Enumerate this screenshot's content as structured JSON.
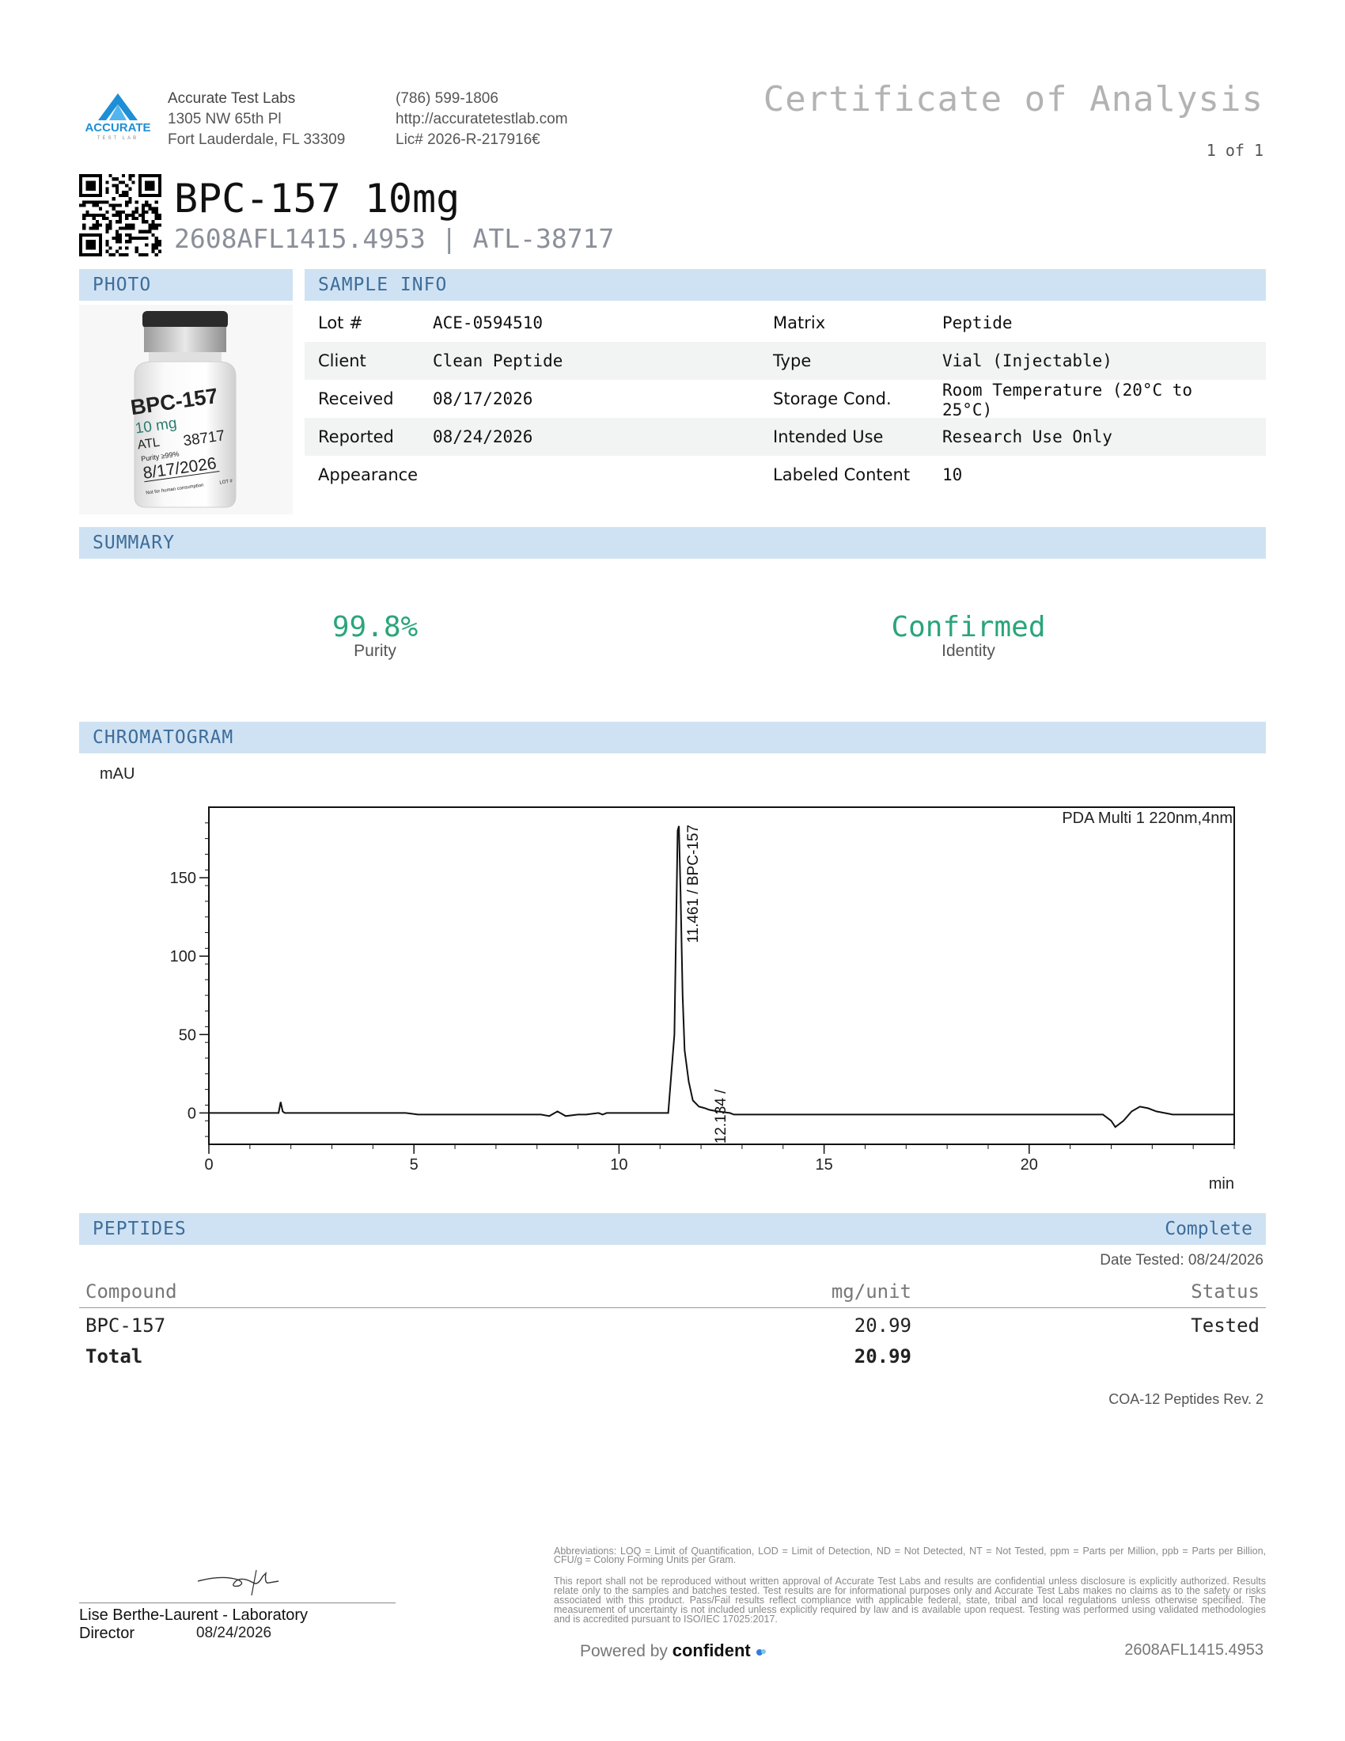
{
  "header": {
    "lab_name": "Accurate Test Labs",
    "address_line1": "1305 NW 65th Pl",
    "address_line2": "Fort Lauderdale, FL 33309",
    "phone": "(786) 599-1806",
    "website": "http://accuratetestlab.com",
    "license": "Lic# 2026-R-217916€",
    "doc_title": "Certificate of Analysis",
    "page": "1 of 1",
    "logo_text": "ACCURATE",
    "logo_subtext": "TEST LAB"
  },
  "product": {
    "name": "BPC-157 10mg",
    "batch_line": "2608AFL1415.4953 | ATL-38717"
  },
  "photo": {
    "section_label": "PHOTO",
    "vial_lines": [
      "BPC-157",
      "10 mg",
      "ATL",
      "38717",
      "Purity ≥99%",
      "8/17/2026",
      "Not for human consumption",
      "LOT #"
    ]
  },
  "sample_info": {
    "section_label": "SAMPLE INFO",
    "rows": [
      {
        "l1": "Lot #",
        "v1": "ACE-0594510",
        "l2": "Matrix",
        "v2": "Peptide"
      },
      {
        "l1": "Client",
        "v1": "Clean Peptide",
        "l2": "Type",
        "v2": "Vial (Injectable)"
      },
      {
        "l1": "Received",
        "v1": "08/17/2026",
        "l2": "Storage Cond.",
        "v2": "Room Temperature (20°C to 25°C)"
      },
      {
        "l1": "Reported",
        "v1": "08/24/2026",
        "l2": "Intended Use",
        "v2": "Research Use Only"
      },
      {
        "l1": "Appearance",
        "v1": "",
        "l2": "Labeled Content",
        "v2": "10"
      }
    ]
  },
  "summary": {
    "section_label": "SUMMARY",
    "purity_value": "99.8%",
    "purity_label": "Purity",
    "identity_value": "Confirmed",
    "identity_label": "Identity",
    "accent_color": "#2aa57a"
  },
  "chromatogram": {
    "section_label": "CHROMATOGRAM"
  },
  "chart_data": {
    "type": "line",
    "title": "",
    "ylabel": "mAU",
    "xlabel": "min",
    "annotation": "PDA Multi 1 220nm,4nm",
    "xlim": [
      0,
      25
    ],
    "ylim": [
      -20,
      195
    ],
    "x_ticks": [
      0,
      5,
      10,
      15,
      20
    ],
    "y_ticks": [
      0,
      50,
      100,
      150
    ],
    "peak_labels": [
      {
        "rt": 11.461,
        "text": "11.461 / BPC-157"
      },
      {
        "rt": 12.134,
        "text": "12.134 /"
      }
    ],
    "series": [
      {
        "x": [
          0,
          1.7,
          1.75,
          1.8,
          1.85,
          1.9,
          4.8,
          5.1,
          8.1,
          8.3,
          8.5,
          8.7,
          9.0,
          9.2,
          9.5,
          9.6,
          9.7,
          10.5,
          11.2,
          11.35,
          11.43,
          11.46,
          11.5,
          11.55,
          11.6,
          11.7,
          11.8,
          11.95,
          12.1,
          12.2,
          12.4,
          12.7,
          12.8,
          13.0,
          15,
          20,
          21.8,
          22.0,
          22.1,
          22.3,
          22.5,
          22.7,
          22.9,
          23.1,
          23.3,
          23.5,
          24,
          25
        ],
        "y": [
          0,
          0,
          7,
          1,
          0,
          0,
          0,
          -1,
          -1,
          -2,
          1,
          -2,
          -1,
          -1,
          0,
          -1,
          0,
          0,
          0,
          50,
          180,
          183,
          140,
          75,
          40,
          20,
          8,
          4,
          3,
          2,
          1,
          0,
          -1,
          -1,
          -1,
          -1,
          -1,
          -5,
          -9,
          -5,
          1,
          4,
          3,
          1,
          0,
          -1,
          -1,
          -1
        ]
      }
    ]
  },
  "peptides": {
    "section_label": "PEPTIDES",
    "status": "Complete",
    "date_tested": "Date Tested: 08/24/2026",
    "headers": [
      "Compound",
      "mg/unit",
      "Status"
    ],
    "rows": [
      {
        "compound": "BPC-157",
        "amount": "20.99",
        "status": "Tested"
      }
    ],
    "total_label": "Total",
    "total_amount": "20.99"
  },
  "footer": {
    "form_rev": "COA-12 Peptides Rev. 2",
    "signer_name": "Lise Berthe-Laurent - Laboratory",
    "signer_title": "Director",
    "sign_date": "08/24/2026",
    "abbreviations": "Abbreviations: LOQ = Limit of Quantification, LOD = Limit of Detection, ND = Not Detected, NT = Not Tested, ppm = Parts per Million, ppb = Parts per Billion, CFU/g = Colony Forming Units per Gram.",
    "disclaimer": "This report shall not be reproduced without written approval of Accurate Test Labs and results are confidential unless disclosure is explicitly authorized. Results relate only to the samples and batches tested. Test results are for informational purposes only and Accurate Test Labs makes no claims as to the safety or risks associated with this product. Pass/Fail results reflect compliance with applicable federal, state, tribal and local regulations unless otherwise specified. The measurement of uncertainty is not included unless explicitly required by law and is available upon request. Testing was performed using validated methodologies and is accredited pursuant to ISO/IEC 17025:2017.",
    "powered_by": "Powered by",
    "brand": "confident",
    "batch_id": "2608AFL1415.4953"
  }
}
